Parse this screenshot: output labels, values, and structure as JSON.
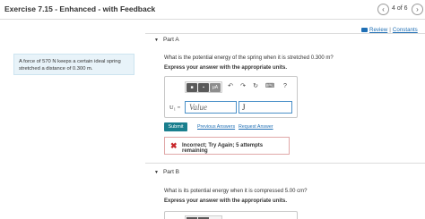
{
  "header": {
    "title": "Exercise 7.15 - Enhanced - with Feedback",
    "page_count": "4 of 6",
    "prev_icon": "chevron-left-icon",
    "next_icon": "chevron-right-icon"
  },
  "links": {
    "review": "Review",
    "constants": "Constants",
    "separator": "|"
  },
  "problem": {
    "statement": "A force of 570 N keeps a certain ideal spring stretched a distance of 0.300 m."
  },
  "part_a": {
    "label": "Part A",
    "question": "What is the potential energy of the spring when it is stretched 0.300 m?",
    "instruction": "Express your answer with the appropriate units.",
    "toolbar": {
      "template_label": "▣ ▣",
      "units_label": "μA",
      "undo_icon": "↶",
      "redo_icon": "↷",
      "reset_icon": "↻",
      "keyboard_icon": "⌨",
      "help_icon": "?"
    },
    "variable_label": "U₁ =",
    "value_placeholder": "Value",
    "units_value": "J",
    "submit_label": "Submit",
    "previous_answers": "Previous Answers",
    "request_answer": "Request Answer",
    "feedback_icon": "✖",
    "feedback_text": "Incorrect; Try Again; 5 attempts remaining"
  },
  "part_b": {
    "label": "Part B",
    "question": "What is its potential energy when it is compressed 5.00 cm?",
    "instruction": "Express your answer with the appropriate units."
  },
  "colors": {
    "accent": "#1a7f8e",
    "link": "#1f6fb5",
    "error": "#c8262a",
    "info_bg": "#e8f3f9"
  }
}
